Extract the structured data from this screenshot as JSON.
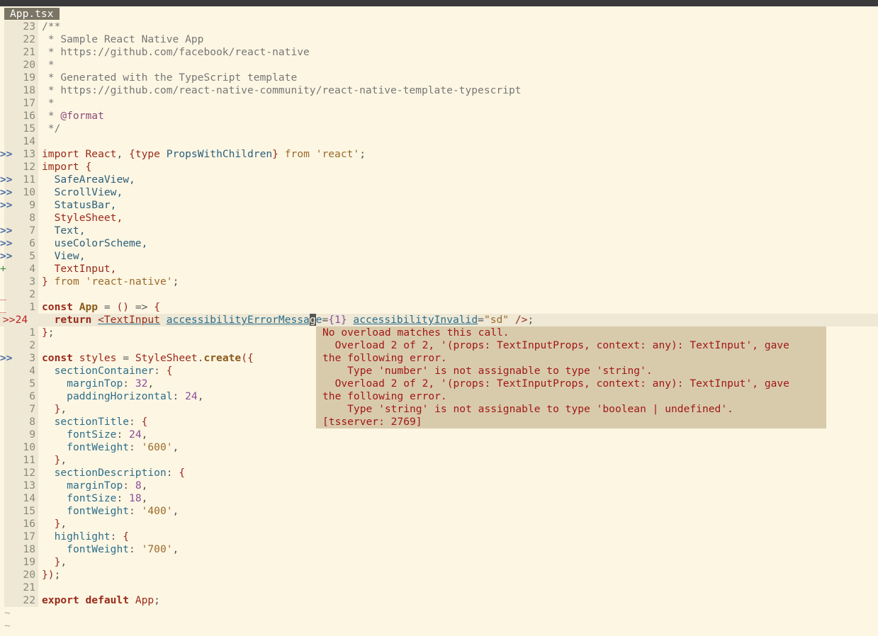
{
  "tab": {
    "title": "App.tsx"
  },
  "colors": {
    "background": "#fdf6e3",
    "gutter": "#eee8d5",
    "popup_bg": "#d8cbab",
    "error_text": "#a01818"
  },
  "gutter": {
    "lines": [
      "23",
      "22",
      "21",
      "20",
      "19",
      "18",
      "17",
      "16",
      "15",
      "14",
      "13",
      "12",
      "11",
      "10",
      "9",
      "8",
      "7",
      "6",
      "5",
      "4",
      "3",
      "2",
      "1",
      ">>24",
      "1",
      "2",
      "3",
      "4",
      "5",
      "6",
      "7",
      "8",
      "9",
      "10",
      "11",
      "12",
      "13",
      "14",
      "15",
      "16",
      "17",
      "18",
      "19",
      "20",
      "21",
      "22"
    ],
    "signs": [
      "",
      "",
      "",
      "",
      "",
      "",
      "",
      "",
      "",
      "",
      ">>",
      "",
      ">>",
      ">>",
      ">>",
      "",
      ">>",
      ">>",
      ">>",
      "+",
      "",
      "_",
      "_",
      "",
      "",
      "",
      ">>",
      "",
      "",
      "",
      "",
      "",
      "",
      "",
      "",
      "",
      "",
      "",
      "",
      "",
      "",
      "",
      "",
      "",
      "",
      ""
    ]
  },
  "code": {
    "l1": "/**",
    "l2": " * Sample React Native App",
    "l3": " * https://github.com/facebook/react-native",
    "l4": " *",
    "l5": " * Generated with the TypeScript template",
    "l6": " * https://github.com/react-native-community/react-native-template-typescript",
    "l7": " *",
    "l8": "@format",
    "l9": " */",
    "import1": {
      "kw": "import",
      "name": "React",
      "t": "type",
      "pw": "PropsWithChildren",
      "from": "from",
      "mod": "'react'"
    },
    "imports": [
      "SafeAreaView,",
      "ScrollView,",
      "StatusBar,",
      "StyleSheet,",
      "Text,",
      "useColorScheme,",
      "View,",
      "TextInput,"
    ],
    "from_rn": "'react-native'",
    "app_const": "const",
    "app_name": "App",
    "ret": "return",
    "jsx_tag": "<TextInput",
    "attr1": "accessibilityErrorMessa",
    "attr1_cursor": "g",
    "attr1_rest": "e",
    "attr1_val": "{1}",
    "attr2": "accessibilityInvalid",
    "attr2_val": "\"sd\"",
    "jsx_close": "/>",
    "styles_const": "const",
    "styles_name": "styles",
    "ss": "StyleSheet",
    "create": "create",
    "section_container": "sectionContainer",
    "margin_top": "marginTop",
    "v32": "32",
    "padding_h": "paddingHorizontal",
    "v24": "24",
    "section_title": "sectionTitle",
    "font_size": "fontSize",
    "font_weight": "fontWeight",
    "v600": "'600'",
    "section_desc": "sectionDescription",
    "v8": "8",
    "v18": "18",
    "v400": "'400'",
    "highlight": "highlight",
    "v700": "'700'",
    "export_kw": "export default",
    "export_name": "App"
  },
  "popup": {
    "lines": [
      "No overload matches this call.",
      "  Overload 2 of 2, '(props: TextInputProps, context: any): TextInput', gave",
      "the following error.",
      "    Type 'number' is not assignable to type 'string'.",
      "  Overload 2 of 2, '(props: TextInputProps, context: any): TextInput', gave",
      "the following error.",
      "    Type 'string' is not assignable to type 'boolean | undefined'.",
      "[tsserver: 2769]"
    ]
  },
  "tildes": [
    "~",
    "~"
  ]
}
